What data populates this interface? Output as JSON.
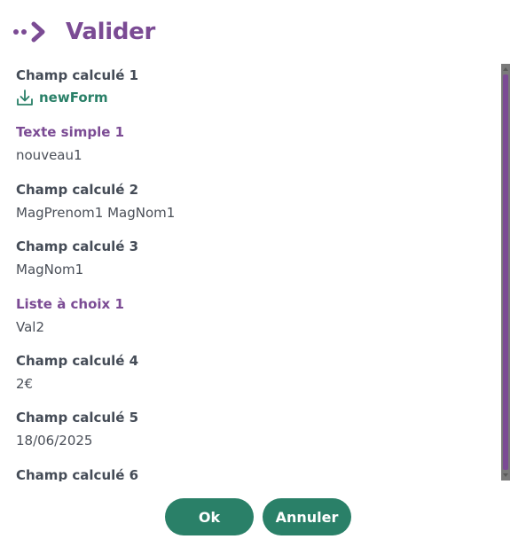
{
  "dialog": {
    "title": "Valider",
    "title_icon": "chevron-dots-icon",
    "accent_color": "#7b4b94",
    "action_color": "#2a8068"
  },
  "fields": [
    {
      "label": "Champ calculé 1",
      "type": "download",
      "value": "newForm",
      "icon": "download-icon"
    },
    {
      "label": "Texte simple 1",
      "value": "nouveau1"
    },
    {
      "label": "Champ calculé 2",
      "value": "MagPrenom1 MagNom1"
    },
    {
      "label": "Champ calculé 3",
      "value": "MagNom1"
    },
    {
      "label": "Liste à choix 1",
      "value": "Val2"
    },
    {
      "label": "Champ calculé 4",
      "value": "2€"
    },
    {
      "label": "Champ calculé 5",
      "value": "18/06/2025"
    },
    {
      "label": "Champ calculé 6"
    }
  ],
  "buttons": {
    "ok": "Ok",
    "cancel": "Annuler"
  }
}
